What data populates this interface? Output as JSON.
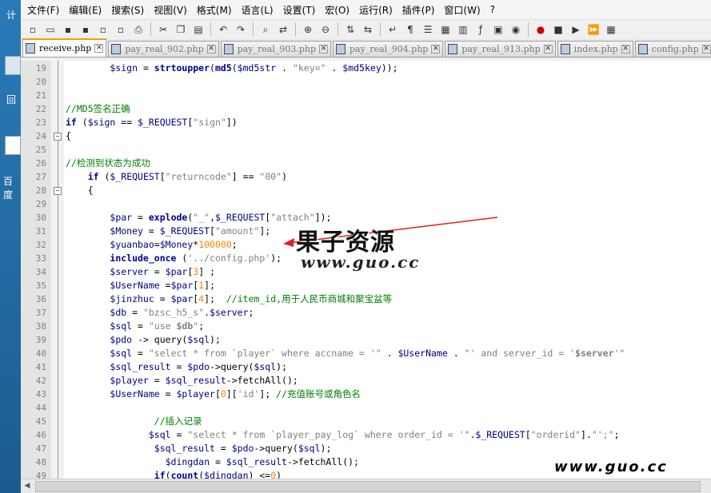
{
  "desktop": {
    "label_top": "计",
    "label_mid": "回",
    "label_bottom": "百度"
  },
  "menu": [
    "文件(F)",
    "编辑(E)",
    "搜索(S)",
    "视图(V)",
    "格式(M)",
    "语言(L)",
    "设置(T)",
    "宏(O)",
    "运行(R)",
    "插件(P)",
    "窗口(W)",
    "?"
  ],
  "tabs": [
    {
      "label": "receive.php",
      "active": true
    },
    {
      "label": "pay_real_902.php"
    },
    {
      "label": "pay_real_903.php"
    },
    {
      "label": "pay_real_904.php"
    },
    {
      "label": "pay_real_913.php"
    },
    {
      "label": "index.php"
    },
    {
      "label": "config.php"
    }
  ],
  "lines": [
    {
      "n": "19",
      "html": "        <span class='var'>$sign</span> = <span class='kw'>strtoupper</span>(<span class='kw'>md5</span>(<span class='var'>$md5str</span> . <span class='str'>\"key=\"</span> . <span class='var'>$md5key</span>));"
    },
    {
      "n": "20",
      "html": ""
    },
    {
      "n": "21",
      "html": ""
    },
    {
      "n": "22",
      "html": "<span class='cm'>//MD5签名正确</span>"
    },
    {
      "n": "23",
      "html": "<span class='kw'>if</span> (<span class='var'>$sign</span> == <span class='var'>$_REQUEST</span>[<span class='str'>\"sign\"</span>])"
    },
    {
      "n": "24",
      "html": "{",
      "fold": true
    },
    {
      "n": "25",
      "html": ""
    },
    {
      "n": "26",
      "html": "<span class='cm'>//检测到状态为成功</span>"
    },
    {
      "n": "27",
      "html": "    <span class='kw'>if</span> (<span class='var'>$_REQUEST</span>[<span class='str'>\"returncode\"</span>] == <span class='str'>\"00\"</span>)"
    },
    {
      "n": "28",
      "html": "    {",
      "fold": true
    },
    {
      "n": "29",
      "html": ""
    },
    {
      "n": "30",
      "html": "        <span class='var'>$par</span> = <span class='kw'>explode</span>(<span class='str'>\"_\"</span>,<span class='var'>$_REQUEST</span>[<span class='str'>\"attach\"</span>]);"
    },
    {
      "n": "31",
      "html": "        <span class='var'>$Money</span> = <span class='var'>$_REQUEST</span>[<span class='str'>\"amount\"</span>];"
    },
    {
      "n": "32",
      "html": "        <span class='var'>$yuanbao</span>=<span class='var'>$Money</span>*<span class='num'>100000</span>;"
    },
    {
      "n": "33",
      "html": "        <span class='kw'>include_once</span> (<span class='str'>'../config.php'</span>);"
    },
    {
      "n": "34",
      "html": "        <span class='var'>$server</span> = <span class='var'>$par</span>[<span class='num'>3</span>] ;"
    },
    {
      "n": "35",
      "html": "        <span class='var'>$UserName</span> =<span class='var'>$par</span>[<span class='num'>1</span>];"
    },
    {
      "n": "36",
      "html": "        <span class='var'>$jinzhuc</span> = <span class='var'>$par</span>[<span class='num'>4</span>];  <span class='cm'>//item_id,用于人民币商城和聚宝盆等</span>"
    },
    {
      "n": "37",
      "html": "        <span class='var'>$db</span> = <span class='str'>\"bzsc_h5_s\"</span>.<span class='var'>$server</span>;"
    },
    {
      "n": "38",
      "html": "        <span class='var'>$sql</span> = <span class='str'>\"use <b>$db</b>\"</span>;"
    },
    {
      "n": "39",
      "html": "        <span class='var'>$pdo</span> -> query(<span class='var'>$sql</span>);"
    },
    {
      "n": "40",
      "html": "        <span class='var'>$sql</span> = <span class='str'>\"select * from `player` where accname = '\"</span> . <span class='var'>$UserName</span> . <span class='str'>\"' and server_id = '<b>$server</b>'\"</span>"
    },
    {
      "n": "41",
      "html": "        <span class='var'>$sql_result</span> = <span class='var'>$pdo</span>->query(<span class='var'>$sql</span>);"
    },
    {
      "n": "42",
      "html": "        <span class='var'>$player</span> = <span class='var'>$sql_result</span>->fetchAll();"
    },
    {
      "n": "43",
      "html": "        <span class='var'>$UserName</span> = <span class='var'>$player</span>[<span class='num'>0</span>][<span class='str'>'id'</span>]; <span class='cm'>//充值账号或角色名</span>"
    },
    {
      "n": "44",
      "html": ""
    },
    {
      "n": "45",
      "html": "                <span class='cm'>//插入记录</span>"
    },
    {
      "n": "46",
      "html": "               <span class='var'>$sql</span> = <span class='str'>\"select * from `player_pay_log` where order_id = '\"</span>.<span class='var'>$_REQUEST</span>[<span class='str'>\"orderid\"</span>].<span class='str'>\"';\"</span>;"
    },
    {
      "n": "47",
      "html": "                <span class='var'>$sql_result</span> = <span class='var'>$pdo</span>->query(<span class='var'>$sql</span>);"
    },
    {
      "n": "48",
      "html": "                  <span class='var'>$dingdan</span> = <span class='var'>$sql_result</span>->fetchAll();"
    },
    {
      "n": "49",
      "html": "                <span class='kw'>if</span>(<span class='kw'>count</span>(<span class='var'>$dingdan</span>) <=<span class='num'>0</span>)"
    }
  ],
  "watermark": {
    "title": "果子资源",
    "url": "www.guo.cc",
    "footer": "www.guo.cc"
  }
}
